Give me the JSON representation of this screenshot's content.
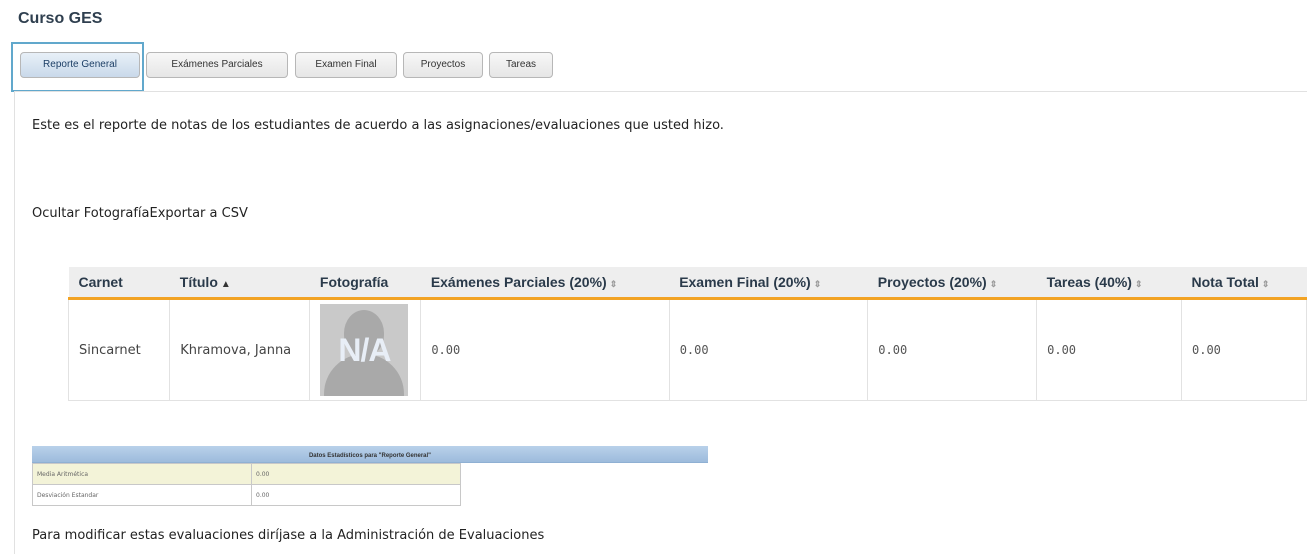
{
  "course": {
    "title": "Curso GES"
  },
  "tabs": [
    {
      "label": "Reporte General",
      "active": true
    },
    {
      "label": "Exámenes Parciales",
      "active": false
    },
    {
      "label": "Examen Final",
      "active": false
    },
    {
      "label": "Proyectos",
      "active": false
    },
    {
      "label": "Tareas",
      "active": false
    }
  ],
  "intro_text": "Este es el reporte de notas de los estudiantes de acuerdo a las asignaciones/evaluaciones que usted hizo.",
  "actions": {
    "hide_photo": "Ocultar Fotografía",
    "export_csv": "Exportar a CSV"
  },
  "grades_table": {
    "headers": [
      "Carnet",
      "Título",
      "Fotografía",
      "Exámenes Parciales (20%)",
      "Examen Final (20%)",
      "Proyectos (20%)",
      "Tareas (40%)",
      "Nota Total"
    ],
    "rows": [
      {
        "carnet": "Sincarnet",
        "nombre": "Khramova, Janna",
        "foto": "N/A",
        "parciales": "0.00",
        "final": "0.00",
        "proyectos": "0.00",
        "tareas": "0.00",
        "total": "0.00"
      }
    ]
  },
  "stats": {
    "title": "Datos Estadísticos para \"Reporte General\"",
    "rows": [
      {
        "label": "Media Aritmética",
        "value": "0.00"
      },
      {
        "label": "Desviación Estandar",
        "value": "0.00"
      }
    ]
  },
  "footer_text": "Para modificar estas evaluaciones diríjase a la Administración de Evaluaciones",
  "colors": {
    "accent_border": "#f2a324",
    "tab_highlight": "#61a8cc",
    "stats_header": "#b9d1ea"
  },
  "icons": {
    "sort_ascending": "triangle-up-icon",
    "sortable": "sort-icon"
  }
}
